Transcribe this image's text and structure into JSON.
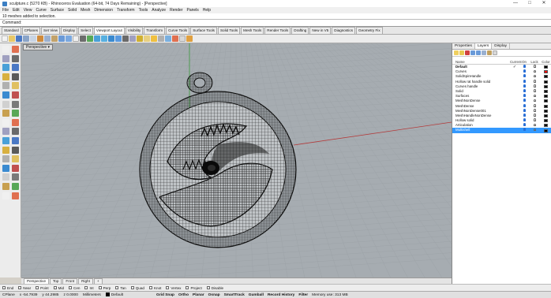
{
  "window": {
    "title": "sculpture.c (5270 KB) - Rhinoceros Evaluation (64-bit, 74 Days Remaining) - [Perspective]",
    "controls": [
      "—",
      "□",
      "✕"
    ]
  },
  "menu": [
    "File",
    "Edit",
    "View",
    "Curve",
    "Surface",
    "Solid",
    "Mesh",
    "Dimension",
    "Transform",
    "Tools",
    "Analyze",
    "Render",
    "Panels",
    "Help"
  ],
  "command_history": "10 meshes added to selection.",
  "command": {
    "label": "Command:",
    "value": ""
  },
  "toolbar_tabs": [
    "Standard",
    "CPlanes",
    "Set View",
    "Display",
    "Select",
    "Viewport Layout",
    "Visibility",
    "Transform",
    "Curve Tools",
    "Surface Tools",
    "Solid Tools",
    "Mesh Tools",
    "Render Tools",
    "Drafting",
    "New in V5",
    "Diagnostics",
    "Geometry Fix"
  ],
  "active_toolbar_tab": "Viewport Layout",
  "viewport": {
    "label": "Perspective ▾"
  },
  "view_tabs": [
    "Perspective",
    "Top",
    "Front",
    "Right"
  ],
  "view_tabs_add": "+",
  "osnaps": [
    "End",
    "Near",
    "Point",
    "Mid",
    "Cen",
    "Int",
    "Perp",
    "Tan",
    "Quad",
    "Knot",
    "Vertex",
    "Project",
    "Disable"
  ],
  "status": {
    "cplane": "CPlane",
    "x": "x -54.7939",
    "y": "y 44.2985",
    "z": "z 0.0000",
    "units": "Millimeters",
    "layer": "Default",
    "panes": [
      "Grid Snap",
      "Ortho",
      "Planar",
      "Osnap",
      "SmartTrack",
      "Gumball",
      "Record History",
      "Filter"
    ],
    "memory": "Memory use: 313 MB"
  },
  "right_panel": {
    "tabs": [
      "Properties",
      "Layers",
      "Display"
    ],
    "active_tab": "Layers",
    "columns": {
      "name": "Name",
      "current": "Current",
      "on": "On",
      "lock": "Lock",
      "color": "Color"
    },
    "layers": [
      {
        "name": "Default",
        "current": "✓",
        "color": "#000000",
        "bold": true
      },
      {
        "name": "Curves",
        "current": "",
        "color": "#ff0000"
      },
      {
        "name": "SolidSpinHandle",
        "current": "",
        "color": "#000000"
      },
      {
        "name": "Hollow rat handle solid",
        "current": "",
        "color": "#000000"
      },
      {
        "name": "Curves handle",
        "current": "",
        "color": "#000000"
      },
      {
        "name": "Solid",
        "current": "",
        "color": "#000000"
      },
      {
        "name": "Surfaces",
        "current": "",
        "color": "#000000"
      },
      {
        "name": "MeshNonDense",
        "current": "",
        "color": "#000000"
      },
      {
        "name": "MeshDense",
        "current": "",
        "color": "#000000"
      },
      {
        "name": "MeshNonDense001",
        "current": "",
        "color": "#000000"
      },
      {
        "name": "MeshHandleNonDense",
        "current": "",
        "color": "#000000"
      },
      {
        "name": "Hollow solid",
        "current": "",
        "color": "#000000"
      },
      {
        "name": "Articulation",
        "current": "",
        "color": "#000000"
      },
      {
        "name": "Multishell",
        "current": "",
        "color": "#000000",
        "selected": true
      }
    ]
  },
  "colors": {
    "viewport_bg": "#a6acb1",
    "grid": "#9da3a8",
    "axis_x": "#b33a3a",
    "axis_y": "#3a9a3a",
    "selection": "#3399ff"
  },
  "icons": {
    "title": "rhino-app-icon",
    "bulb": "lightbulb-icon",
    "lock": "lock-icon"
  }
}
